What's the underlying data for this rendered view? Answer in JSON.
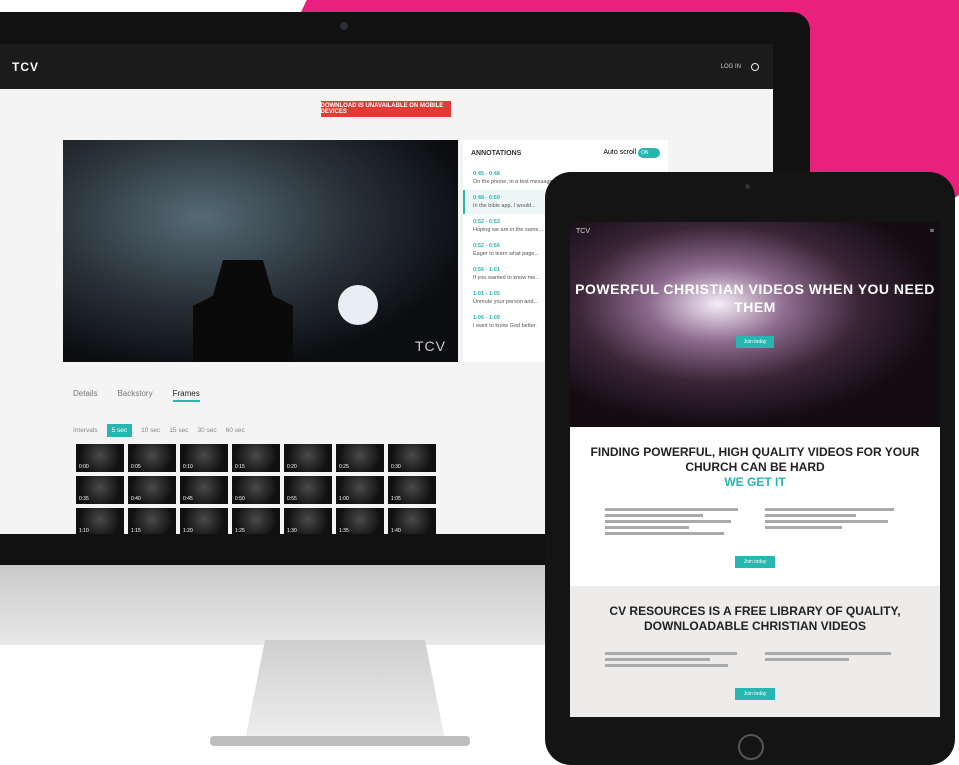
{
  "imac": {
    "brand": "TCV",
    "login": "LOG IN",
    "banner": "DOWNLOAD IS UNAVAILABLE ON MOBILE DEVICES",
    "video_watermark": "TCV",
    "annotations": {
      "title": "ANNOTATIONS",
      "auto_scroll_label": "Auto scroll",
      "toggle": "ON",
      "items": [
        {
          "time": "0:45 - 0:48",
          "text": "On the phone, in a text message"
        },
        {
          "time": "0:48 - 0:50",
          "text": "In the bible app. I would..."
        },
        {
          "time": "0:52 - 0:53",
          "text": "Hoping we are in the same..."
        },
        {
          "time": "0:52 - 0:56",
          "text": "Eager to learn what page..."
        },
        {
          "time": "0:56 - 1:01",
          "text": "If you wanted to know me..."
        },
        {
          "time": "1:01 - 1:05",
          "text": "Unmute your person and..."
        },
        {
          "time": "1:06 - 1:09",
          "text": "I want to know God better."
        }
      ]
    },
    "tabs": [
      "Details",
      "Backstory",
      "Frames"
    ],
    "intervals_label": "Intervals",
    "intervals": [
      "5 sec",
      "10 sec",
      "15 sec",
      "30 sec",
      "60 sec"
    ],
    "frames": [
      "0:00",
      "0:05",
      "0:10",
      "0:15",
      "0:20",
      "0:25",
      "0:30",
      "0:35",
      "0:40",
      "0:45",
      "0:50",
      "0:55",
      "1:00",
      "1:05",
      "1:10",
      "1:15",
      "1:20",
      "1:25",
      "1:30",
      "1:35",
      "1:40"
    ]
  },
  "ipad": {
    "brand": "TCV",
    "hero_title": "POWERFUL CHRISTIAN VIDEOS WHEN YOU NEED THEM",
    "hero_button": "Join today",
    "section2_title": "FINDING POWERFUL, HIGH QUALITY VIDEOS FOR YOUR CHURCH CAN BE HARD",
    "section2_accent": "WE GET IT",
    "section2_button": "Join today",
    "section3_title": "CV RESOURCES IS A FREE LIBRARY OF QUALITY, DOWNLOADABLE CHRISTIAN VIDEOS",
    "section3_button": "Join today"
  },
  "colors": {
    "accent": "#28b7b0",
    "pink": "#e8217e",
    "banner": "#e53935"
  }
}
